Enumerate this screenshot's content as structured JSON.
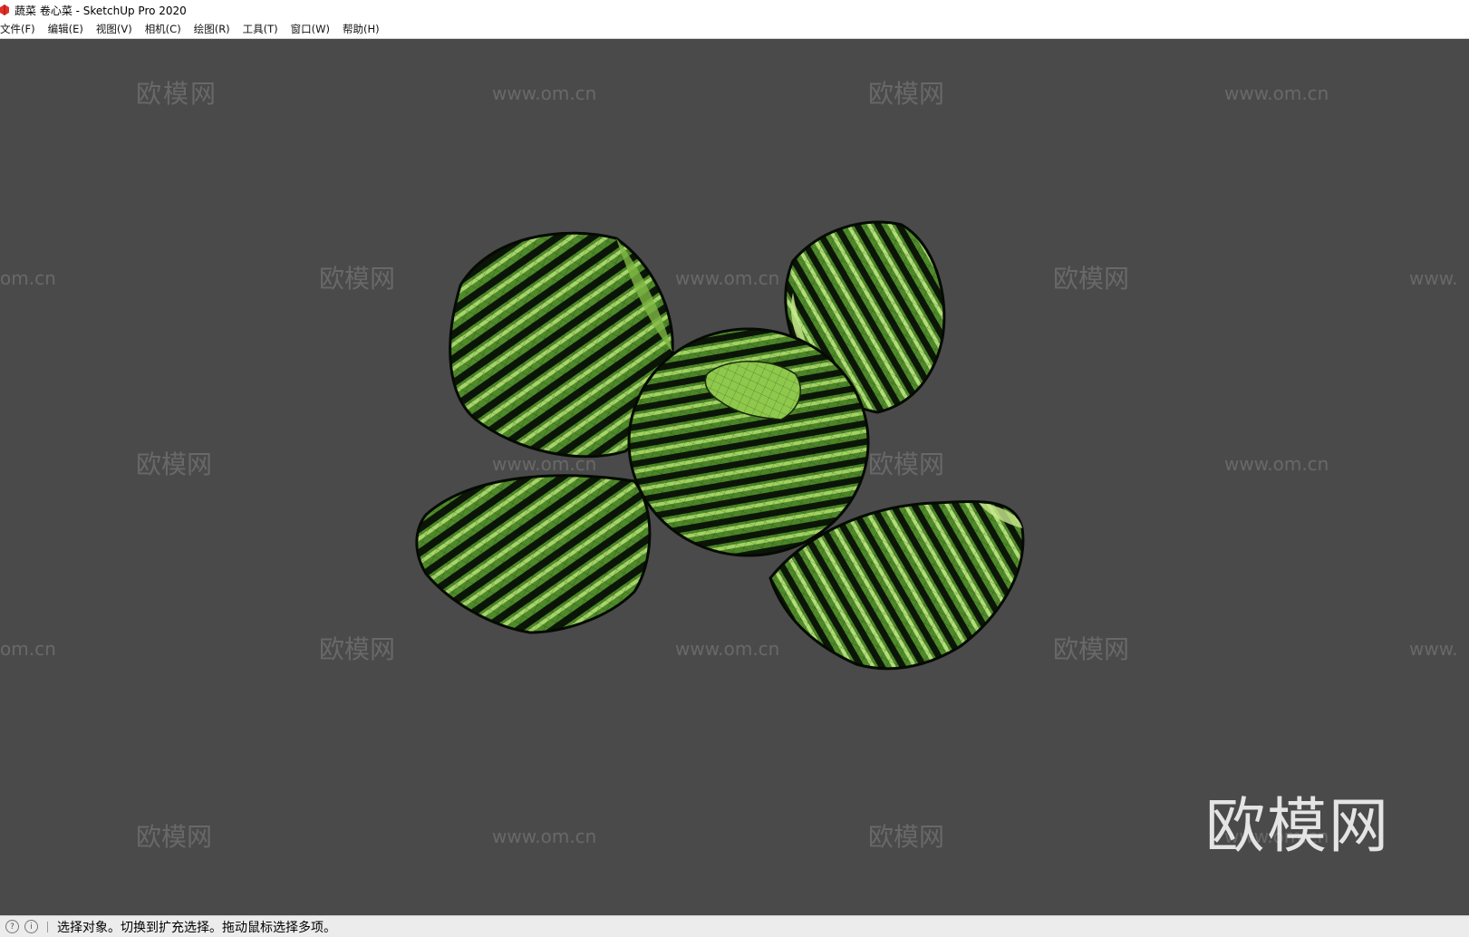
{
  "window": {
    "title": "蔬菜 卷心菜 - SketchUp Pro 2020",
    "app_icon": "sketchup-logo-icon",
    "accent_color": "#e0302a"
  },
  "menubar": {
    "items": [
      "文件(F)",
      "编辑(E)",
      "视图(V)",
      "相机(C)",
      "绘图(R)",
      "工具(T)",
      "窗口(W)",
      "帮助(H)"
    ]
  },
  "viewport": {
    "background": "#4a4a4a",
    "model": "cabbage-leaves-wireframe",
    "watermarks": {
      "brand": "欧模网",
      "url": "www.om.cn",
      "url_fragment_left": "om.cn",
      "url_fragment_right": "www.",
      "big_brand": "欧模网"
    }
  },
  "statusbar": {
    "icons": [
      "help-icon",
      "info-icon"
    ],
    "message": "选择对象。切换到扩充选择。拖动鼠标选择多项。"
  }
}
